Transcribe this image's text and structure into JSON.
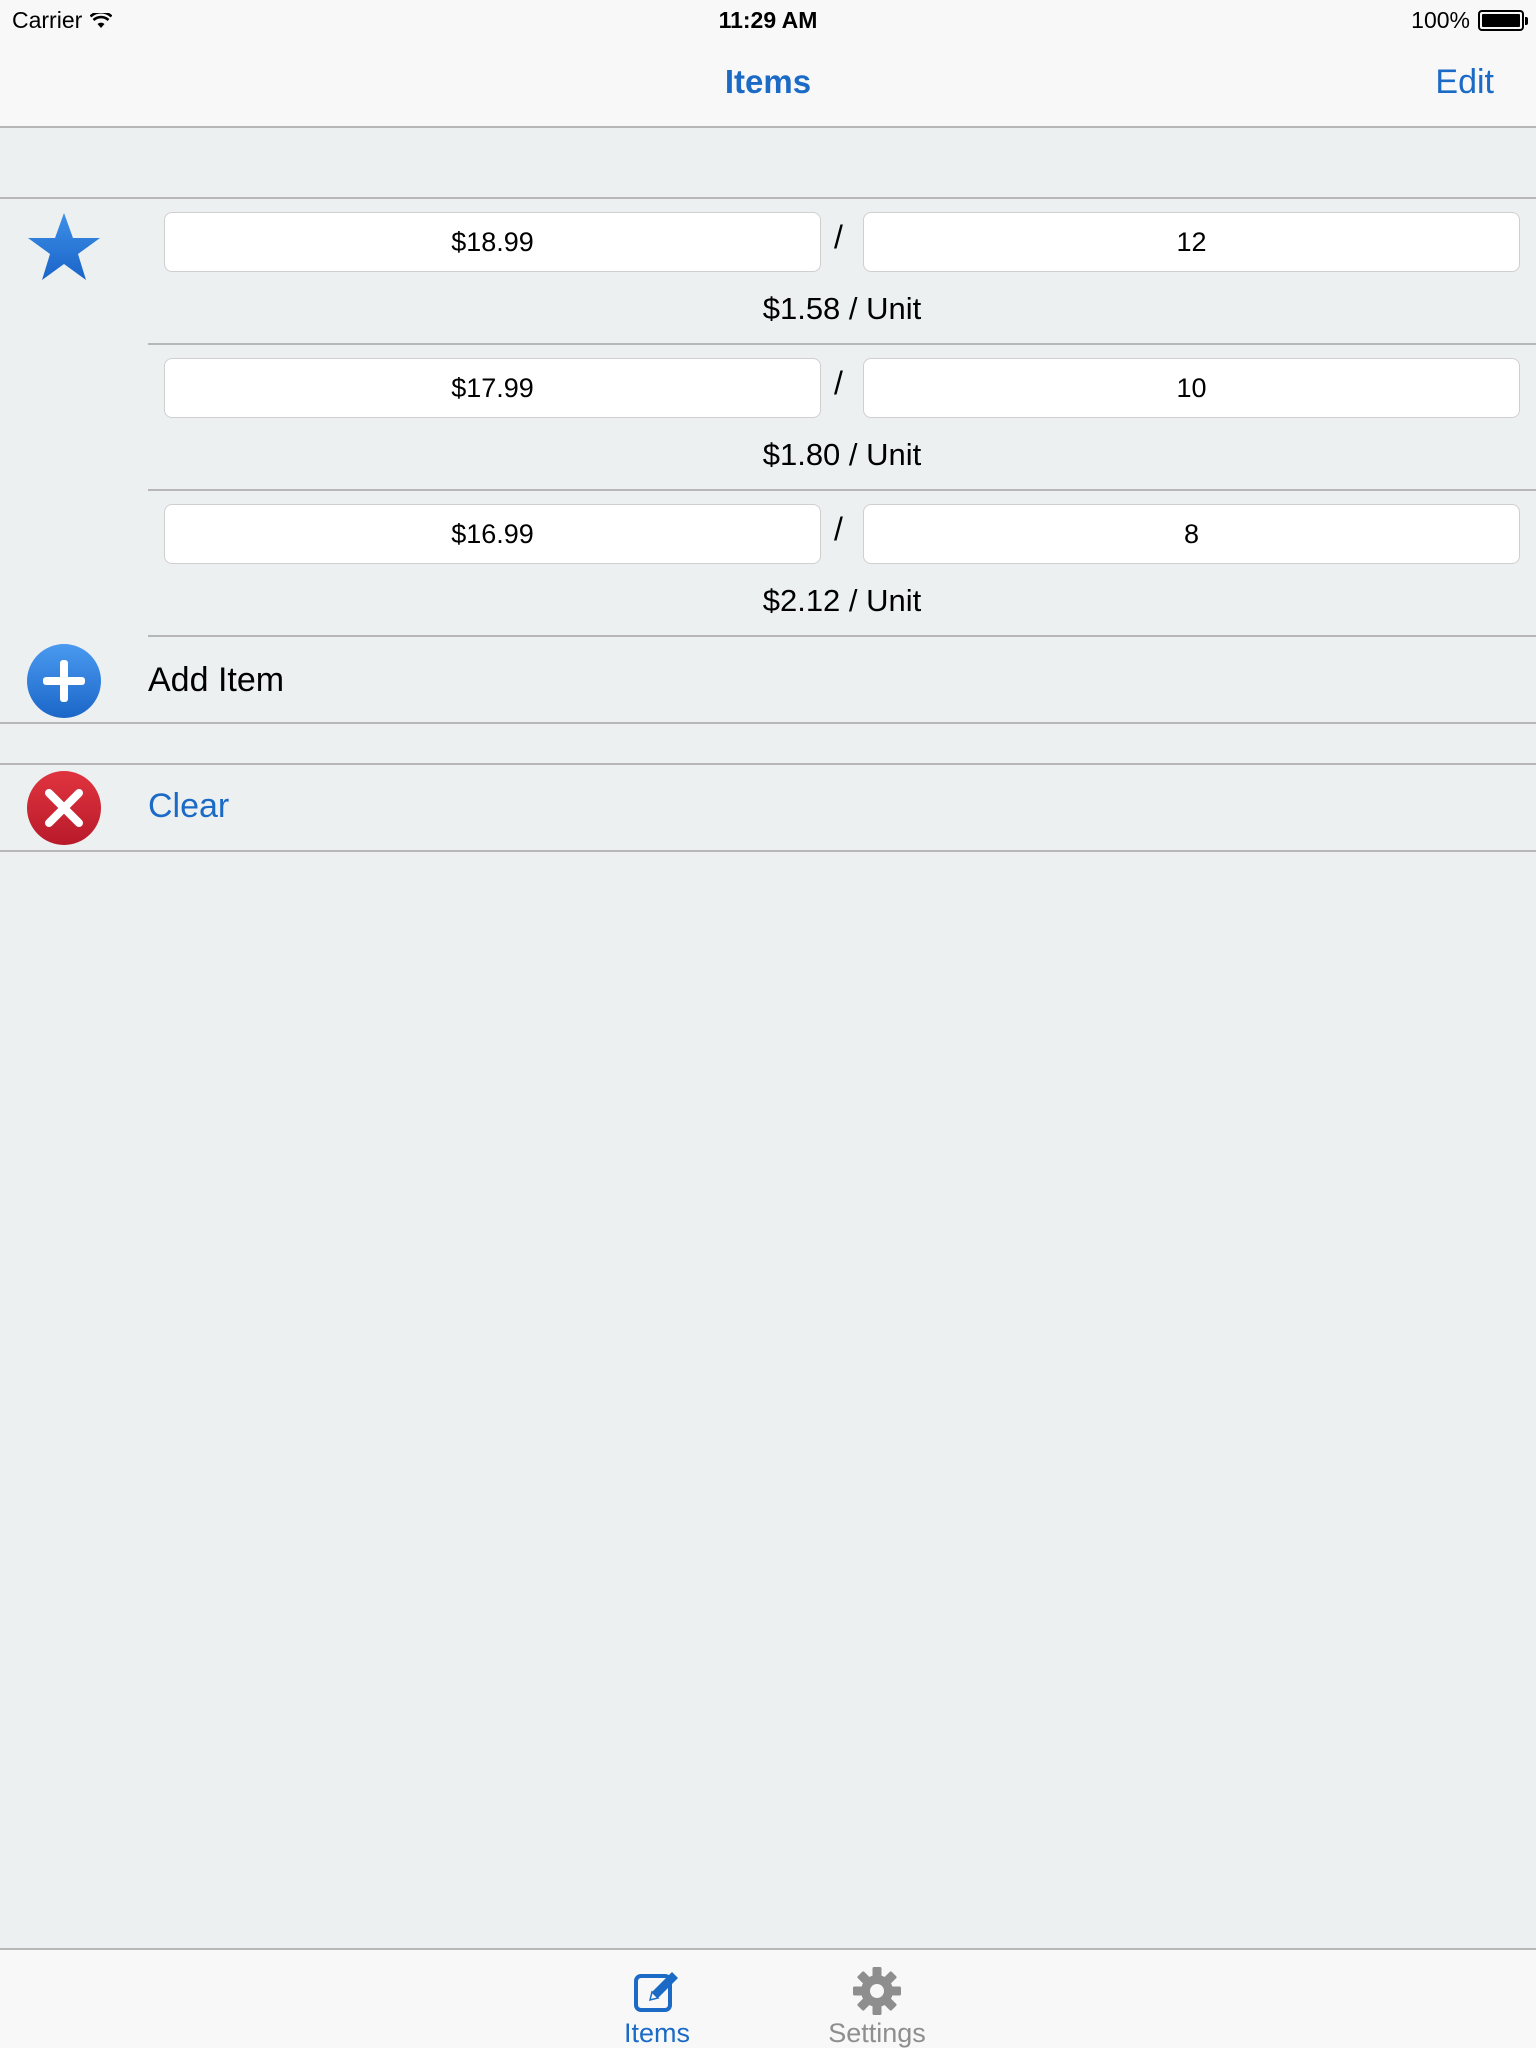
{
  "status_bar": {
    "carrier": "Carrier",
    "time": "11:29 AM",
    "battery": "100%"
  },
  "nav": {
    "title": "Items",
    "edit_label": "Edit"
  },
  "items": [
    {
      "price": "$18.99",
      "quantity": "12",
      "separator": "/",
      "per_unit": "$1.58 / Unit"
    },
    {
      "price": "$17.99",
      "quantity": "10",
      "separator": "/",
      "per_unit": "$1.80 / Unit"
    },
    {
      "price": "$16.99",
      "quantity": "8",
      "separator": "/",
      "per_unit": "$2.12 / Unit"
    }
  ],
  "actions": {
    "add_item": "Add Item",
    "clear": "Clear"
  },
  "tabbar": {
    "items_label": "Items",
    "settings_label": "Settings"
  },
  "colors": {
    "accent": "#1b6ac6",
    "add": "#2a7ad8",
    "clear": "#c62233",
    "background": "#edf0f1"
  },
  "icons": {
    "favorite": "star-icon",
    "add": "plus-circle-icon",
    "clear": "x-circle-icon",
    "tab_items": "compose-icon",
    "tab_settings": "gear-icon"
  }
}
